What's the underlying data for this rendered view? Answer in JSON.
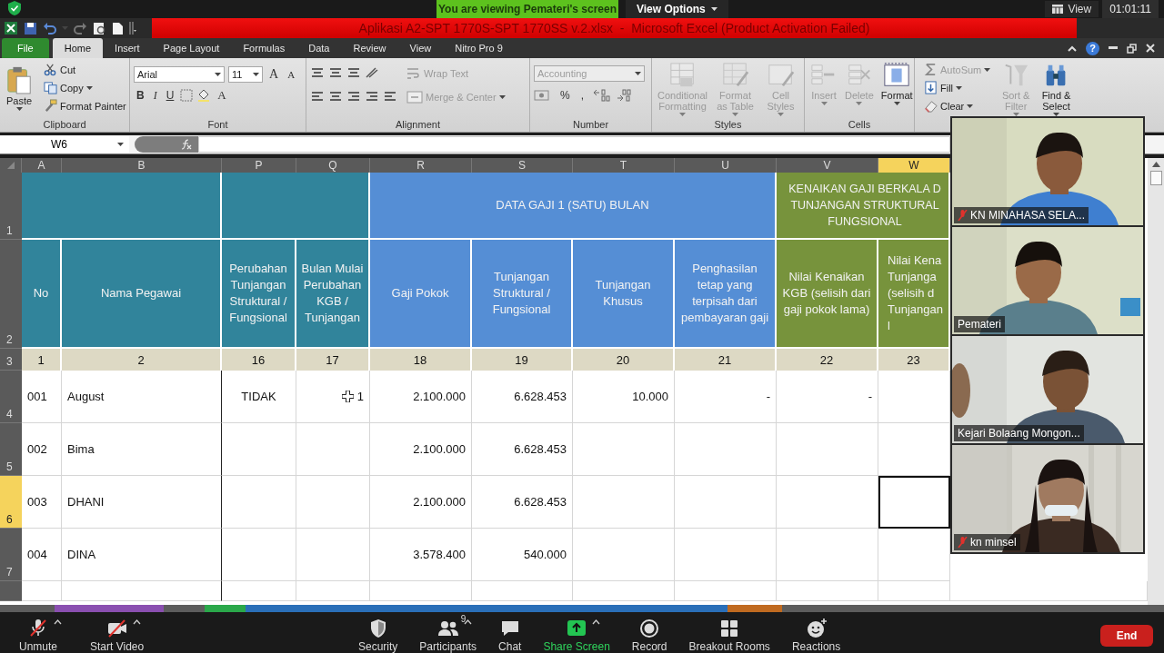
{
  "meeting": {
    "banner": "You are viewing Pemateri's screen",
    "view_options": "View Options",
    "view": "View",
    "timer": "01:01:11"
  },
  "excel": {
    "title": "Aplikasi A2-SPT 1770S-SPT 1770SS v.2.xlsx  -  Microsoft Excel (Product Activation Failed)",
    "tabs": [
      {
        "label": "File",
        "kind": "file",
        "selected": false
      },
      {
        "label": "Home",
        "kind": "tab",
        "selected": true
      },
      {
        "label": "Insert",
        "kind": "tab",
        "selected": false
      },
      {
        "label": "Page Layout",
        "kind": "tab",
        "selected": false
      },
      {
        "label": "Formulas",
        "kind": "tab",
        "selected": false
      },
      {
        "label": "Data",
        "kind": "tab",
        "selected": false
      },
      {
        "label": "Review",
        "kind": "tab",
        "selected": false
      },
      {
        "label": "View",
        "kind": "tab",
        "selected": false
      },
      {
        "label": "Nitro Pro 9",
        "kind": "tab",
        "selected": false
      }
    ],
    "help": "?",
    "ribbon": {
      "clipboard": {
        "label": "Clipboard",
        "paste": "Paste",
        "items": [
          {
            "label": "Cut",
            "kind": "cut",
            "menu": false
          },
          {
            "label": "Copy",
            "kind": "copy",
            "menu": true
          },
          {
            "label": "Format Painter",
            "kind": "painter",
            "menu": false
          }
        ]
      },
      "font": {
        "label": "Font",
        "family": "Arial",
        "size": "11",
        "grow": "A",
        "shrink": "A",
        "styles": [
          "B",
          "I",
          "U"
        ],
        "color_button": "A"
      },
      "alignment": {
        "label": "Alignment",
        "wrap": {
          "label": "Wrap Text",
          "disabled": true
        },
        "merge": {
          "label": "Merge & Center",
          "disabled": true
        }
      },
      "number": {
        "label": "Number",
        "format": "Accounting",
        "format_disabled": true,
        "symbols": [
          "%",
          ","
        ]
      },
      "styles": {
        "label": "Styles",
        "buttons": [
          {
            "label": "Conditional Formatting",
            "kind": "conditional",
            "disabled": true
          },
          {
            "label": "Format as Table",
            "kind": "table",
            "disabled": true
          },
          {
            "label": "Cell Styles",
            "kind": "cellstyle",
            "disabled": true
          }
        ]
      },
      "cells": {
        "label": "Cells",
        "buttons": [
          {
            "label": "Insert",
            "kind": "insert",
            "disabled": true
          },
          {
            "label": "Delete",
            "kind": "delete",
            "disabled": true
          },
          {
            "label": "Format",
            "kind": "format",
            "disabled": false
          }
        ]
      },
      "editing": {
        "small": [
          {
            "label": "AutoSum",
            "kind": "sum",
            "disabled": true
          },
          {
            "label": "Fill",
            "kind": "fill",
            "disabled": false
          },
          {
            "label": "Clear",
            "kind": "clear",
            "disabled": false
          }
        ],
        "big": [
          {
            "label": "Sort & Filter",
            "kind": "sort",
            "disabled": true
          },
          {
            "label": "Find & Select",
            "kind": "find",
            "disabled": false
          }
        ]
      }
    },
    "name_box": "W6",
    "columns": [
      {
        "letter": "A",
        "selected": false
      },
      {
        "letter": "B",
        "selected": false
      },
      {
        "letter": "P",
        "selected": false
      },
      {
        "letter": "Q",
        "selected": false
      },
      {
        "letter": "R",
        "selected": false
      },
      {
        "letter": "S",
        "selected": false
      },
      {
        "letter": "T",
        "selected": false
      },
      {
        "letter": "U",
        "selected": false
      },
      {
        "letter": "V",
        "selected": false
      },
      {
        "letter": "W",
        "selected": true
      }
    ],
    "header_row_numbers": [
      "1",
      "2",
      "3"
    ],
    "group_headers": [
      "DATA GAJI 1 (SATU) BULAN",
      "KENAIKAN GAJI BERKALA D\nTUNJANGAN STRUKTURAL\nFUNGSIONAL"
    ],
    "column_titles": [
      "No",
      "Nama Pegawai",
      "Perubahan Tunjangan Struktural / Fungsional",
      "Bulan Mulai Perubahan KGB / Tunjangan",
      "Gaji Pokok",
      "Tunjangan Struktural / Fungsional",
      "Tunjangan Khusus",
      "Penghasilan tetap  yang terpisah dari pembayaran gaji",
      "Nilai Kenaikan KGB (selisih dari gaji pokok lama)",
      "Nilai Kena\nTunjanga\n(selisih d\nTunjangan l"
    ],
    "index_numbers": [
      "1",
      "2",
      "16",
      "17",
      "18",
      "19",
      "20",
      "21",
      "22",
      "23"
    ],
    "rows": [
      {
        "number": "4",
        "selected": false,
        "no": "001",
        "name": "August",
        "change": "TIDAK",
        "month": "1",
        "salary": "2.100.000",
        "allowance": "6.628.453",
        "special": "10.000",
        "fixed_income": "-",
        "kgb_increase": "-"
      },
      {
        "number": "5",
        "selected": false,
        "no": "002",
        "name": "Bima",
        "salary": "2.100.000",
        "allowance": "6.628.453"
      },
      {
        "number": "6",
        "selected": true,
        "no": "003",
        "name": "DHANI",
        "salary": "2.100.000",
        "allowance": "6.628.453"
      },
      {
        "number": "7",
        "selected": false,
        "no": "004",
        "name": "DINA",
        "salary": "3.578.400",
        "allowance": "540.000"
      }
    ]
  },
  "video_tiles": [
    {
      "name": "KN MINAHASA SELA...",
      "muted": true
    },
    {
      "name": "Pemateri",
      "muted": false
    },
    {
      "name": "Kejari Bolaang Mongon...",
      "muted": false
    },
    {
      "name": "kn minsel",
      "muted": true
    }
  ],
  "toolbar": [
    {
      "label": "Unmute",
      "kind": "mic",
      "menu": true
    },
    {
      "label": "Start Video",
      "kind": "video",
      "menu": true
    },
    {
      "label": "Security",
      "kind": "security",
      "menu": false
    },
    {
      "label": "Participants",
      "kind": "participants",
      "count": "9",
      "menu": true
    },
    {
      "label": "Chat",
      "kind": "chat",
      "menu": false
    },
    {
      "label": "Share Screen",
      "kind": "share",
      "menu": true
    },
    {
      "label": "Record",
      "kind": "record",
      "menu": false
    },
    {
      "label": "Breakout Rooms",
      "kind": "breakout",
      "menu": false
    },
    {
      "label": "Reactions",
      "kind": "reactions",
      "menu": false
    }
  ],
  "end_button": "End"
}
